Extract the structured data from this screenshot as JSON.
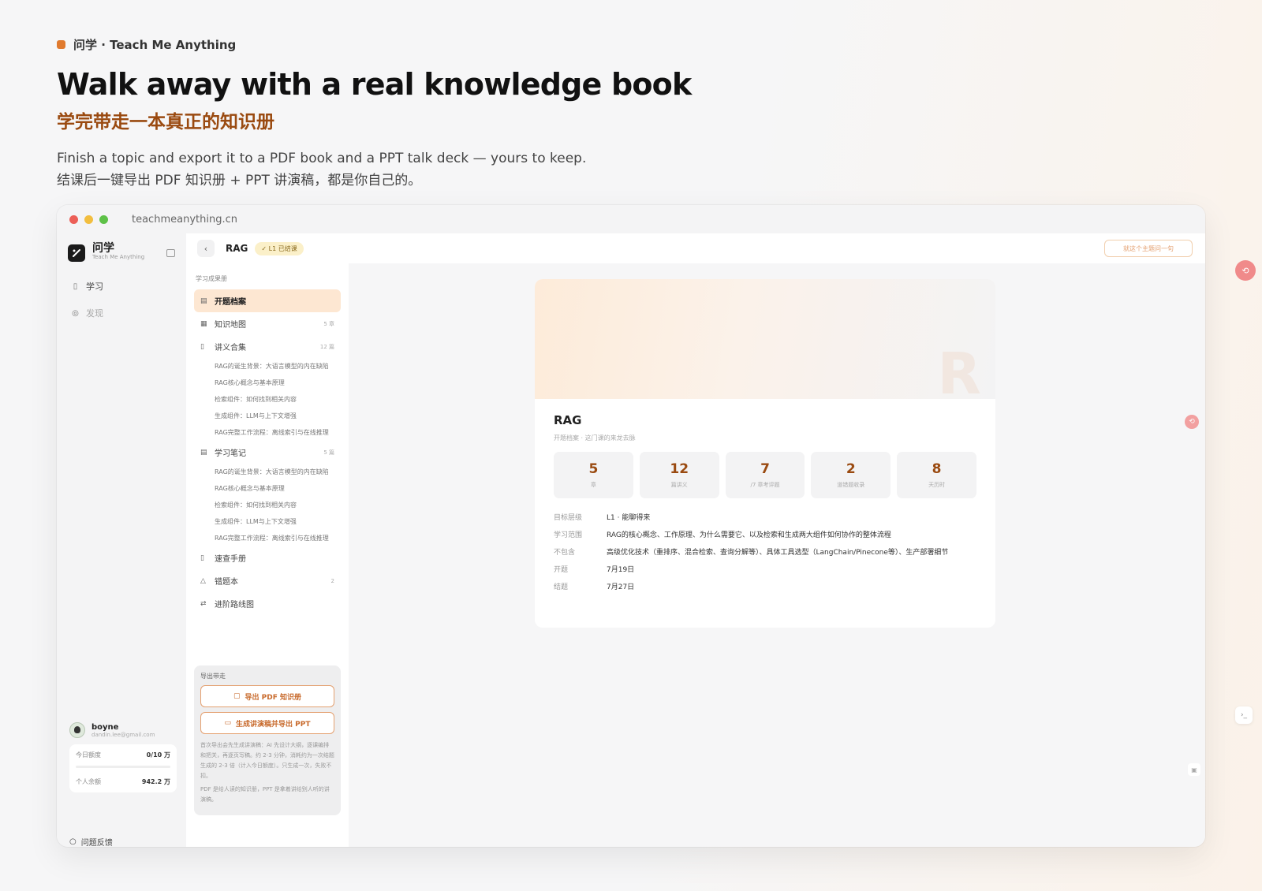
{
  "hero": {
    "brand": "问学 · Teach Me Anything",
    "title": "Walk away with a real knowledge book",
    "subtitle": "学完带走一本真正的知识册",
    "desc_en": "Finish a topic and export it to a PDF book and a PPT talk deck — yours to keep.",
    "desc_zh": "结课后一键导出 PDF 知识册 + PPT 讲演稿，都是你自己的。"
  },
  "window": {
    "url": "teachmeanything.cn"
  },
  "sidebar": {
    "logo_name": "问学",
    "logo_sub": "Teach Me Anything",
    "nav": [
      {
        "label": "学习",
        "icon": "book-icon"
      },
      {
        "label": "发现",
        "icon": "compass-icon"
      }
    ],
    "user": {
      "name": "boyne",
      "email": "dandin.lee@gmail.com",
      "quota_today_label": "今日额度",
      "quota_today_value": "0/10 万",
      "quota_today_fraction": 0,
      "balance_label": "个人余额",
      "balance_value": "942.2 万"
    },
    "feedback": "问题反馈"
  },
  "topbar": {
    "back": "‹",
    "title": "RAG",
    "badge": "✓ L1 已结课",
    "ask": "就这个主题问一句"
  },
  "outline": {
    "label": "学习成果册",
    "items": [
      {
        "label": "开题档案",
        "icon": "file-icon",
        "count": "",
        "active": true,
        "children": []
      },
      {
        "label": "知识地图",
        "icon": "map-icon",
        "count": "5 章",
        "children": []
      },
      {
        "label": "讲义合集",
        "icon": "book-icon",
        "count": "12 篇",
        "children": [
          "RAG的诞生背景：大语言模型的内在缺陷",
          "RAG核心概念与基本原理",
          "检索组件：如何找到相关内容",
          "生成组件：LLM与上下文增强",
          "RAG完整工作流程：离线索引与在线推理"
        ]
      },
      {
        "label": "学习笔记",
        "icon": "note-icon",
        "count": "5 篇",
        "children": [
          "RAG的诞生背景：大语言模型的内在缺陷",
          "RAG核心概念与基本原理",
          "检索组件：如何找到相关内容",
          "生成组件：LLM与上下文增强",
          "RAG完整工作流程：离线索引与在线推理"
        ]
      },
      {
        "label": "速查手册",
        "icon": "bookmark-icon",
        "count": "",
        "children": []
      },
      {
        "label": "错题本",
        "icon": "warning-icon",
        "count": "2",
        "children": []
      },
      {
        "label": "进阶路线图",
        "icon": "route-icon",
        "count": "",
        "children": []
      }
    ],
    "export": {
      "label": "导出带走",
      "pdf_button": "导出 PDF 知识册",
      "ppt_button": "生成讲演稿并导出 PPT",
      "note1": "首次导出会先生成讲演稿：AI 先设计大纲，逐课编排和把关，再逐页写稿。约 2-3 分钟，消耗约为一次结题生成的 2-3 倍（计入今日额度）。只生成一次，失败不扣。",
      "note2": "PDF 是给人读的知识册，PPT 是拿着讲给别人听的讲演稿。"
    }
  },
  "cover": {
    "letter": "R",
    "title": "RAG",
    "subtitle": "开题档案 · 这门课的来龙去脉",
    "stats": [
      {
        "num": "5",
        "label": "章"
      },
      {
        "num": "12",
        "label": "篇讲义"
      },
      {
        "num": "7",
        "label": "/7 章考评题"
      },
      {
        "num": "2",
        "label": "道错题收录"
      },
      {
        "num": "8",
        "label": "天历时"
      }
    ],
    "meta": [
      {
        "key": "目标层级",
        "val": "L1 · 能聊得来"
      },
      {
        "key": "学习范围",
        "val": "RAG的核心概念、工作原理、为什么需要它、以及检索和生成两大组件如何协作的整体流程"
      },
      {
        "key": "不包含",
        "val": "高级优化技术（重排序、混合检索、查询分解等）、具体工具选型（LangChain/Pinecone等）、生产部署细节"
      },
      {
        "key": "开题",
        "val": "7月19日"
      },
      {
        "key": "结题",
        "val": "7月27日"
      }
    ]
  },
  "colors": {
    "accent": "#e07a2e",
    "accent_dark": "#9a4a10",
    "active_bg": "#fde7d2"
  }
}
